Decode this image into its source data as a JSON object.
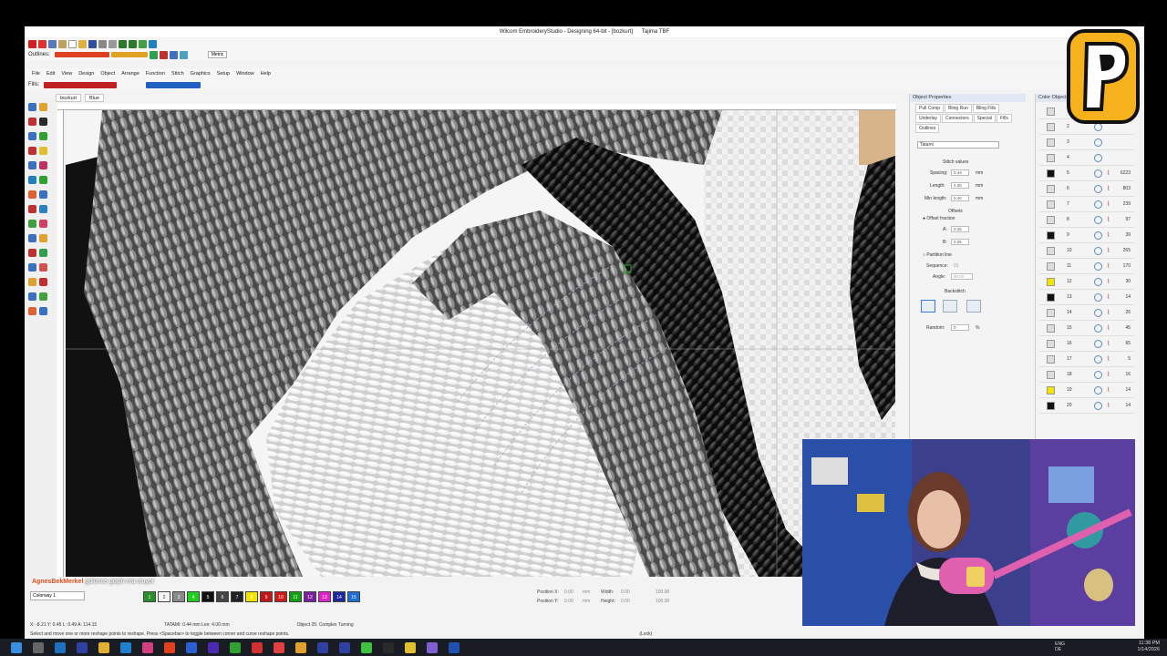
{
  "window": {
    "title": "Wilcom EmbroideryStudio - Designing 64-bit - [bozkurt]",
    "machine": "Tajima TBF"
  },
  "toolbar": {
    "outlines_label": "Outlines:",
    "fills_label": "Fills:",
    "units": "Metric"
  },
  "menu": [
    "File",
    "Edit",
    "View",
    "Design",
    "Object",
    "Arrange",
    "Function",
    "Stitch",
    "Graphics",
    "Setup",
    "Window",
    "Help"
  ],
  "tabs": [
    "bozkurt",
    "Blue"
  ],
  "object_properties": {
    "title": "Object Properties",
    "tabs": [
      "Pull Comp",
      "Bling Run",
      "Bling Fills",
      "Underlay",
      "Connectors",
      "Special",
      "Fills",
      "Outlines"
    ],
    "fill_type": "Tatami",
    "stitch_values_label": "Stitch values",
    "spacing": {
      "label": "Spacing:",
      "value": "0.44",
      "unit": "mm"
    },
    "length": {
      "label": "Length:",
      "value": "4.00",
      "unit": "mm"
    },
    "min_length": {
      "label": "Min length:",
      "value": "0.40",
      "unit": "mm"
    },
    "offsets_label": "Offsets",
    "offset_fraction": "Offset fraction",
    "a": {
      "label": "A:",
      "value": "0.25"
    },
    "b": {
      "label": "B:",
      "value": "0.25"
    },
    "partition_line": "Partition line",
    "sequence": {
      "label": "Sequence:",
      "value": "01"
    },
    "angle": {
      "label": "Angle:",
      "value": "90.00"
    },
    "backstitch_label": "Backstitch",
    "random": {
      "label": "Random:",
      "value": "0",
      "unit": "%"
    }
  },
  "color_object_list": {
    "title": "Color Object List",
    "rows": [
      {
        "n": "1",
        "count": ""
      },
      {
        "n": "2",
        "count": ""
      },
      {
        "n": "3",
        "count": ""
      },
      {
        "n": "4",
        "count": ""
      },
      {
        "n": "5",
        "count": "6223"
      },
      {
        "n": "6",
        "count": "803"
      },
      {
        "n": "7",
        "count": "239"
      },
      {
        "n": "8",
        "count": "97"
      },
      {
        "n": "9",
        "count": "39"
      },
      {
        "n": "10",
        "count": "265"
      },
      {
        "n": "11",
        "count": "170"
      },
      {
        "n": "12",
        "count": "30"
      },
      {
        "n": "13",
        "count": "14"
      },
      {
        "n": "14",
        "count": "26"
      },
      {
        "n": "15",
        "count": "45"
      },
      {
        "n": "16",
        "count": "65"
      },
      {
        "n": "17",
        "count": "5"
      },
      {
        "n": "18",
        "count": "16"
      },
      {
        "n": "19",
        "count": "14"
      },
      {
        "n": "20",
        "count": "14"
      }
    ]
  },
  "chat_overlay": {
    "user": "AgnesBekMerkel",
    "message": "gülünce güçlü mü oluyor"
  },
  "colorway": "Colorway 1",
  "palette": [
    "1",
    "2",
    "3",
    "4",
    "5",
    "6",
    "7",
    "8",
    "9",
    "10",
    "11",
    "12",
    "13",
    "14",
    "15"
  ],
  "palette_colors": [
    "#2a8f2a",
    "#f5f5f5",
    "#8a8a8a",
    "#1ecf1e",
    "#111111",
    "#444444",
    "#222222",
    "#f2e600",
    "#c01818",
    "#d01a1a",
    "#12a012",
    "#7a1fa0",
    "#e020c8",
    "#1a2a9a",
    "#1a6fd0"
  ],
  "position": {
    "x_label": "Position X:",
    "y_label": "Position Y:",
    "x": "0.00",
    "y": "0.00",
    "unit": "mm"
  },
  "size": {
    "w_label": "Width:",
    "h_label": "Height:",
    "w": "0.00",
    "h": "0.00",
    "w_pct": "100.00",
    "h_pct": "100.00"
  },
  "status": {
    "coords": "X: -8.21 Y: 0.45 L: 0.49 A: 114.15",
    "stitch_info": "TATAMI: 0.44 mm Len: 4.00 mm",
    "object": "Object 25: Complex Turning",
    "hint": "Select and move one or more reshape points to reshape. Press <Spacebar> to toggle between corner and curve reshape points.",
    "lock": "(Lock)"
  },
  "tray": {
    "lang": "ENG\nDE",
    "time": "11:38 PM",
    "date": "1/14/2026"
  }
}
